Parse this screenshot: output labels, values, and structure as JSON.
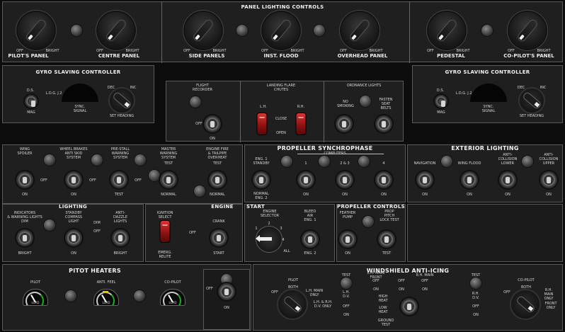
{
  "panel_lighting": {
    "title": "PANEL LIGHTING CONTROLS",
    "knobs": [
      {
        "label": "PILOT'S PANEL",
        "off": "OFF",
        "bright": "BRIGHT"
      },
      {
        "label": "CENTRE  PANEL",
        "off": "OFF",
        "bright": "BRIGHT"
      },
      {
        "label": "SIDE PANELS",
        "off": "OFF",
        "bright": "BRIGHT"
      },
      {
        "label": "INST. FLOOD",
        "off": "OFF",
        "bright": "BRIGHT"
      },
      {
        "label": "OVERHEAD  PANEL",
        "off": "OFF",
        "bright": "BRIGHT"
      },
      {
        "label": "PEDESTAL",
        "off": "OFF",
        "bright": "BRIGHT"
      },
      {
        "label": "CO-PILOT'S PANEL",
        "off": "OFF",
        "bright": "BRIGHT"
      }
    ]
  },
  "gyro_left": {
    "title": "GYRO SLAVING CONTROLLER",
    "ds": "D.S.",
    "ldg": "L.D.G. J.2",
    "mag": "MAG",
    "sync": "SYNC.\nSIGNAL",
    "dec": "DEC",
    "inc": "INC",
    "set_heading": "SET HEADING"
  },
  "gyro_right": {
    "title": "GYRO SLAVING CONTROLLER",
    "ds": "D.S.",
    "ldg": "L.D.G. J.2",
    "mag": "MAG",
    "sync": "SYNC.\nSIGNAL",
    "dec": "DEC",
    "inc": "INC",
    "set_heading": "SET HEADING"
  },
  "flight_recorder": {
    "title": "FLIGHT\nRECORDER",
    "off": "OFF",
    "on": "ON"
  },
  "landing_flare": {
    "title": "LANDING FLARE\nCHUTES",
    "lh": "L.H.",
    "rh": "R.H.",
    "close": "CLOSE",
    "open": "OPEN"
  },
  "ordnance": {
    "title": "ORDNANCE LIGHTS",
    "no_smoking": "NO\nSMOKING",
    "fasten": "FASTEN\nSEAT\nBELTS"
  },
  "warning": {
    "switches": [
      {
        "title": "WING\nSPOILER",
        "bottom": "ON",
        "side": "OFF"
      },
      {
        "title": "WHEEL BRAKES\nANTI SKID\nSYSTEM",
        "bottom": "ON",
        "side": "OFF"
      },
      {
        "title": "PRE-STALL\nWARNING\nSYSTEM",
        "bottom": "TEST",
        "side": "OFF"
      },
      {
        "title": "MASTER\nWARNING\nSYSTEM",
        "bottom": "NORMAL",
        "top": "TEST"
      },
      {
        "title": "ENGINE FIRE\n& TAILPIPE\nOVERHEAT",
        "bottom": "NORMAL",
        "top": "TEST"
      }
    ]
  },
  "lighting": {
    "title": "LIGHTING",
    "items": [
      {
        "title": "INDICATORS\n& WARNING LIGHTS\nDIM",
        "bottom": "BRIGHT"
      },
      {
        "title": "STANDBY\nCOMPASS\nLIGHT",
        "bottom": "ON",
        "side": "DIM\n\nOFF"
      },
      {
        "title": "ANTI-\nDAZZLE\nLIGHTS",
        "bottom": "BRIGHT"
      }
    ]
  },
  "engine": {
    "title": "ENGINE",
    "ign_select": "IGNITION\nSELECT",
    "emerg": "EMERG.\nRELITE",
    "crank": "CRANK",
    "off": "OFF",
    "start": "START"
  },
  "prop_sync": {
    "title": "PROPELLER  SYNCHROPHASE",
    "computers": "COMPUTERS",
    "eng1": "ENG. 1\nSTANDBY",
    "normal": "NORMAL\nENG. 2",
    "nums": [
      "1",
      "2 & 3",
      "4"
    ],
    "on": "ON",
    "off": "OFF"
  },
  "start": {
    "title": "START",
    "engine_selector": "ENGINE\nSELECTOR",
    "nums": [
      "1",
      "2",
      "3",
      "4"
    ],
    "all": "ALL",
    "bleed": "BLEED\nAIR\nENG. 1",
    "eng2": "ENG. 2"
  },
  "prop_controls": {
    "title": "PROPELLER CONTROLS",
    "feather": "FEATHER\nPUMP",
    "prop_pitch": "PROP\nPITCH\nLOCK TEST",
    "on": "ON",
    "test": "TEST"
  },
  "exterior": {
    "title": "EXTERIOR LIGHTING",
    "items": [
      {
        "title": "NAVIGATION",
        "bottom": "ON"
      },
      {
        "title": "WING FLOOD",
        "bottom": "ON"
      },
      {
        "title": "ANTI-\nCOLLISION\nLOWER",
        "bottom": "ON"
      },
      {
        "title": "ANTI-\nCOLLISION\nUPPER",
        "bottom": "ON"
      }
    ]
  },
  "pitot": {
    "title": "PITOT HEATERS",
    "gauges": [
      {
        "title": "PILOT",
        "text": "LOAD"
      },
      {
        "title": "ANTI. FEEL",
        "text": "LOAD"
      },
      {
        "title": "CO-PILOT",
        "text": "LOAD"
      }
    ],
    "switch_side": "OFF",
    "switch_on": "ON"
  },
  "windshield": {
    "title": "WINDSHIELD ANTI-ICING",
    "pilot": "PILOT",
    "off": "OFF",
    "both": "BOTH",
    "lh_main": "L.H. MAIN\nONLY",
    "lhrh": "L.H. & R.H.\nD.V. ONLY",
    "test": "TEST",
    "lh_front": "L.H. MAIN\nFRONT",
    "rh_main": "R.H. MAIN",
    "off_on": "OFF\n\nON",
    "lh_dv": "L.H.\nD.V.",
    "rh_dv": "R.H.\nD.V.",
    "high_heat": "HIGH\nHEAT",
    "low_heat": "LOW\nHEAT",
    "ground_test": "GROUND\nTEST",
    "copilot": "CO-PILOT",
    "rh_main_only": "R.H. MAIN\nONLY",
    "front_only": "FRONT\nONLY"
  },
  "colors": {
    "panel": "#1f1f1f",
    "border": "#5a5a5a",
    "red_switch": "#b01515",
    "gauge_green": "#22aa22",
    "gauge_yellow": "#e5c400"
  }
}
